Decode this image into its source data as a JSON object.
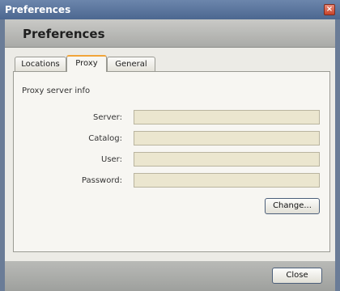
{
  "window": {
    "title": "Preferences",
    "close_glyph": "×"
  },
  "header": {
    "title": "Preferences"
  },
  "tabs": [
    {
      "label": "Locations",
      "active": false
    },
    {
      "label": "Proxy",
      "active": true
    },
    {
      "label": "General",
      "active": false
    }
  ],
  "proxy": {
    "section_label": "Proxy server info",
    "fields": [
      {
        "label": "Server:",
        "value": ""
      },
      {
        "label": "Catalog:",
        "value": ""
      },
      {
        "label": "User:",
        "value": ""
      },
      {
        "label": "Password:",
        "value": ""
      }
    ],
    "change_button": "Change..."
  },
  "footer": {
    "close_button": "Close"
  },
  "colors": {
    "titlebar": "#4c6790",
    "field_bg": "#ebe6cf",
    "active_tab_accent": "#f1a43a"
  }
}
